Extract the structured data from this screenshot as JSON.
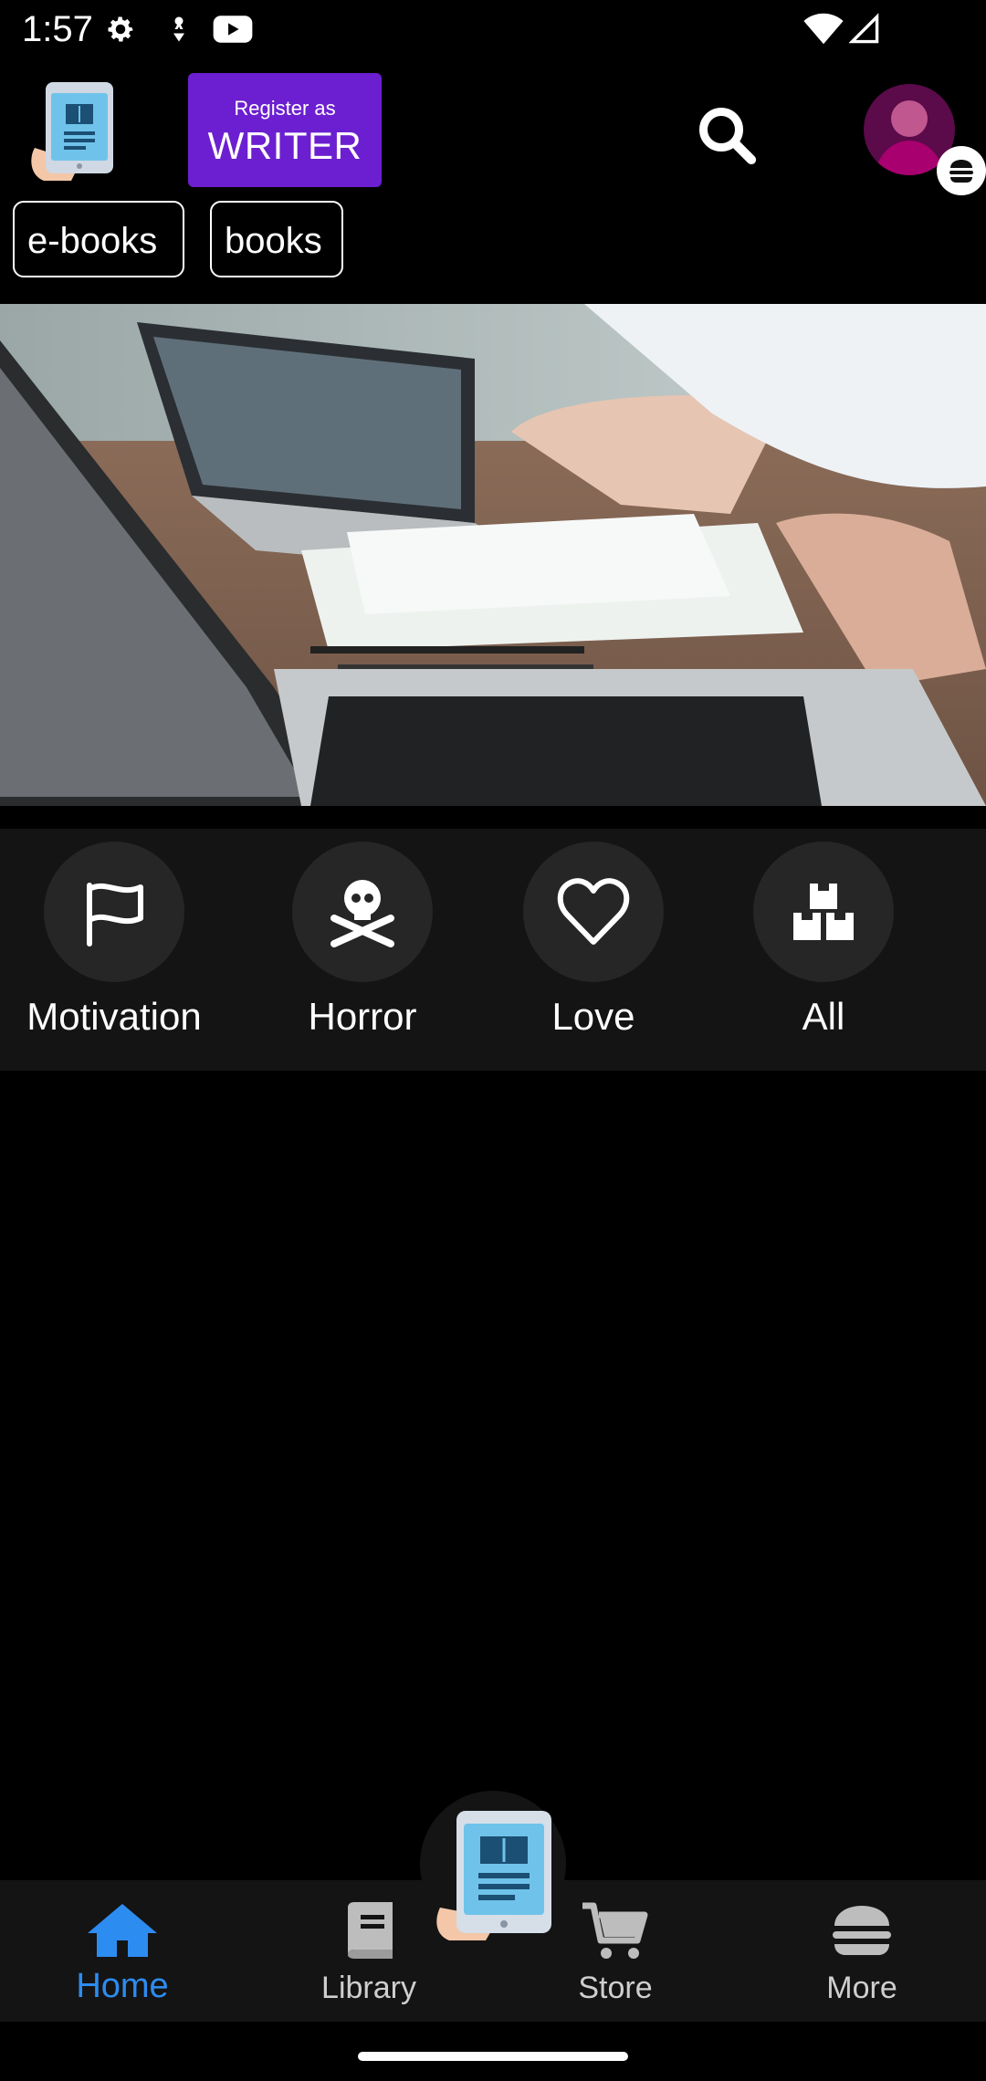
{
  "status_bar": {
    "time": "1:57"
  },
  "header": {
    "register_small": "Register as",
    "register_big": "WRITER",
    "icons": [
      "app-logo-icon",
      "search-icon",
      "avatar-icon",
      "menu-burger-icon"
    ]
  },
  "chips": [
    "e-books",
    "books"
  ],
  "categories": [
    {
      "label": "Motivation",
      "icon": "flag-icon"
    },
    {
      "label": "Horror",
      "icon": "skull-crossbones-icon"
    },
    {
      "label": "Love",
      "icon": "heart-icon"
    },
    {
      "label": "All",
      "icon": "boxes-icon"
    }
  ],
  "bottom_nav": [
    {
      "label": "Home",
      "icon": "home-icon",
      "active": true
    },
    {
      "label": "Library",
      "icon": "book-icon",
      "active": false
    },
    {
      "label": "Store",
      "icon": "cart-icon",
      "active": false
    },
    {
      "label": "More",
      "icon": "burger-icon",
      "active": false
    }
  ],
  "colors": {
    "accent": "#6c1fd0",
    "active_nav": "#2d8cf0",
    "panel": "#141414",
    "background": "#000000"
  }
}
